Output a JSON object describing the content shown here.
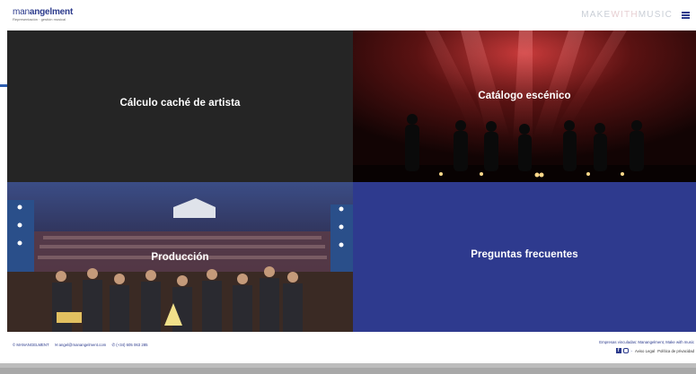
{
  "header": {
    "logo_part1": "man",
    "logo_part2": "angelment",
    "logo_tagline": "Representación · gestión musical",
    "brand_part1": "MAKE",
    "brand_part2": "WITH",
    "brand_part3": "MUSIC"
  },
  "tiles": [
    {
      "title": "Cálculo caché de artista"
    },
    {
      "title": "Catálogo escénico"
    },
    {
      "title": "Producción"
    },
    {
      "title": "Preguntas frecuentes"
    }
  ],
  "footer": {
    "copyright": "© MANANGELMENT",
    "email": "✉ angel@manangelment.com",
    "phone": "✆ (+34) 605 063 285",
    "related": "Empresas vinculadas: Manangelment, Make with music",
    "legal": "Aviso Legal",
    "privacy": "Política de privacidad",
    "separator": "-"
  },
  "colors": {
    "brand_blue": "#2b3a8c",
    "faq_tile": "#2e3a8e",
    "cache_tile": "#252525"
  },
  "icons": {
    "menu": "hamburger-icon",
    "facebook": "facebook-icon",
    "instagram": "instagram-icon"
  }
}
